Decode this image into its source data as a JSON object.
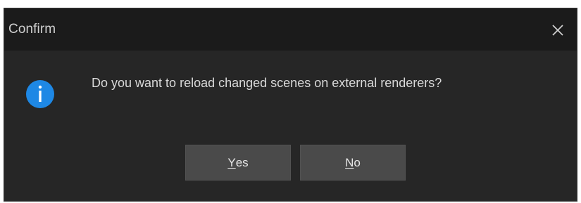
{
  "dialog": {
    "title": "Confirm",
    "message": "Do you want to reload changed scenes on external renderers?",
    "icon": "info-icon",
    "close_icon": "close-icon",
    "buttons": {
      "yes": {
        "mnemonic": "Y",
        "rest": "es"
      },
      "no": {
        "mnemonic": "N",
        "rest": "o"
      }
    },
    "colors": {
      "background": "#262626",
      "titlebar": "#1b1b1b",
      "button": "#4a4a4a",
      "info_blue": "#1e88e5"
    }
  }
}
